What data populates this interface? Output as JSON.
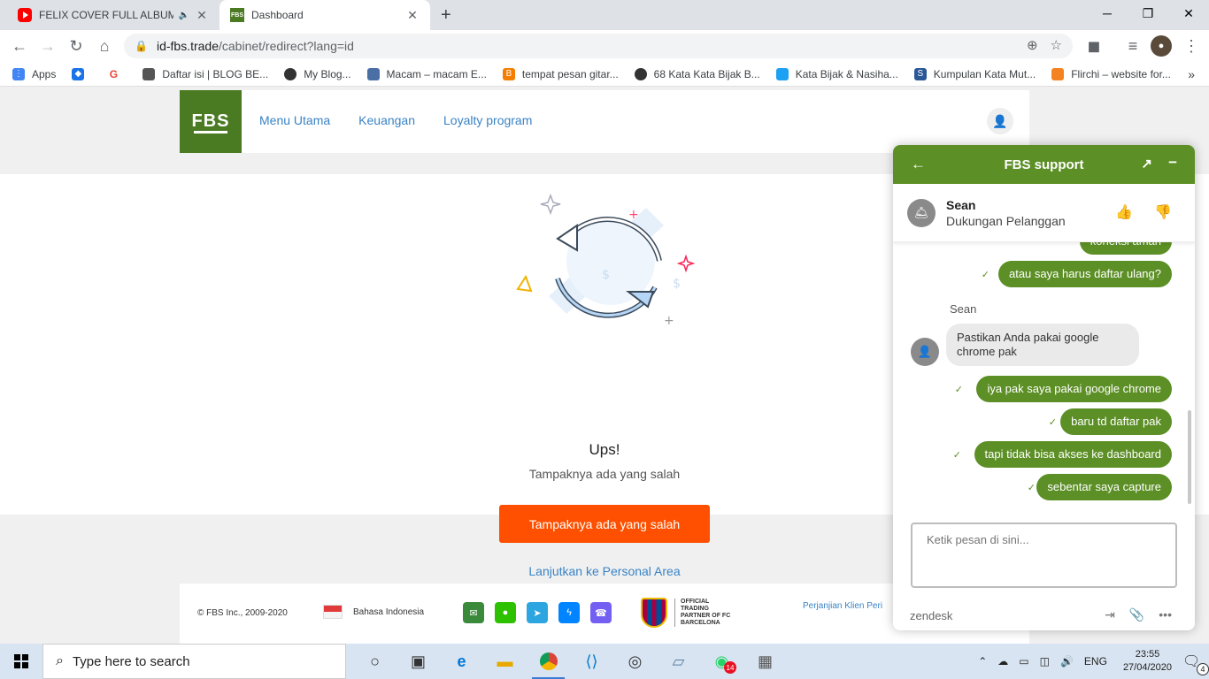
{
  "browser": {
    "tabs": [
      {
        "title": "FELIX COVER FULL ALBUM TE",
        "icon": "youtube-icon",
        "audio": "🔈"
      },
      {
        "title": "Dashboard",
        "icon": "fbs-icon",
        "favicon_text": "FBS"
      }
    ],
    "new_tab": "+",
    "url_host": "id-fbs.trade",
    "url_path": "/cabinet/redirect?lang=id",
    "bookmarks": [
      {
        "label": "Apps",
        "color": "#4285f4"
      },
      {
        "label": "",
        "color": "#1a73e8"
      },
      {
        "label": "",
        "color": "#ea4335",
        "glyph": "G"
      },
      {
        "label": "Daftar isi | BLOG BE...",
        "color": "#555555"
      },
      {
        "label": "My Blog...",
        "color": "#333333"
      },
      {
        "label": "Macam – macam E...",
        "color": "#4a6fa5"
      },
      {
        "label": "tempat pesan gitar...",
        "color": "#f57d00"
      },
      {
        "label": "68 Kata Kata Bijak B...",
        "color": "#333333"
      },
      {
        "label": "Kata Bijak & Nasiha...",
        "color": "#1da1f2"
      },
      {
        "label": "Kumpulan Kata Mut...",
        "color": "#2b5797"
      },
      {
        "label": "Flirchi – website for...",
        "color": "#f58220"
      }
    ],
    "bookmarks_more": "»"
  },
  "site": {
    "logo": "FBS",
    "nav": [
      "Menu Utama",
      "Keuangan",
      "Loyalty program"
    ],
    "error_title": "Ups!",
    "error_subtitle": "Tampaknya ada yang salah",
    "error_button": "Tampaknya ada yang salah",
    "personal_area_link": "Lanjutkan ke Personal Area",
    "accent_color": "#fe5000",
    "brand_color": "#4a7a22"
  },
  "footer": {
    "copyright": "© FBS Inc., 2009-2020",
    "language": "Bahasa Indonesia",
    "partner_text": "OFFICIAL TRADING PARTNER OF FC BARCELONA",
    "links": "Perjanjian Klien   Peri"
  },
  "chat": {
    "title": "FBS support",
    "agent_name": "Sean",
    "agent_role": "Dukungan Pelanggan",
    "partial_message": "koneksi aman",
    "messages_out_top": [
      "atau saya harus daftar ulang?"
    ],
    "sender_label": "Sean",
    "message_in": "Pastikan Anda pakai google chrome pak",
    "messages_out": [
      "iya pak saya pakai google chrome",
      "baru td daftar pak",
      "tapi tidak bisa akses ke dashboard",
      "sebentar saya capture"
    ],
    "input_placeholder": "Ketik pesan di sini...",
    "branding": "zendesk",
    "header_color": "#5c8f25"
  },
  "taskbar": {
    "search_placeholder": "Type here to search",
    "language": "ENG",
    "time": "23:55",
    "date": "27/04/2020",
    "whatsapp_badge": "14",
    "notification_count": "4"
  }
}
